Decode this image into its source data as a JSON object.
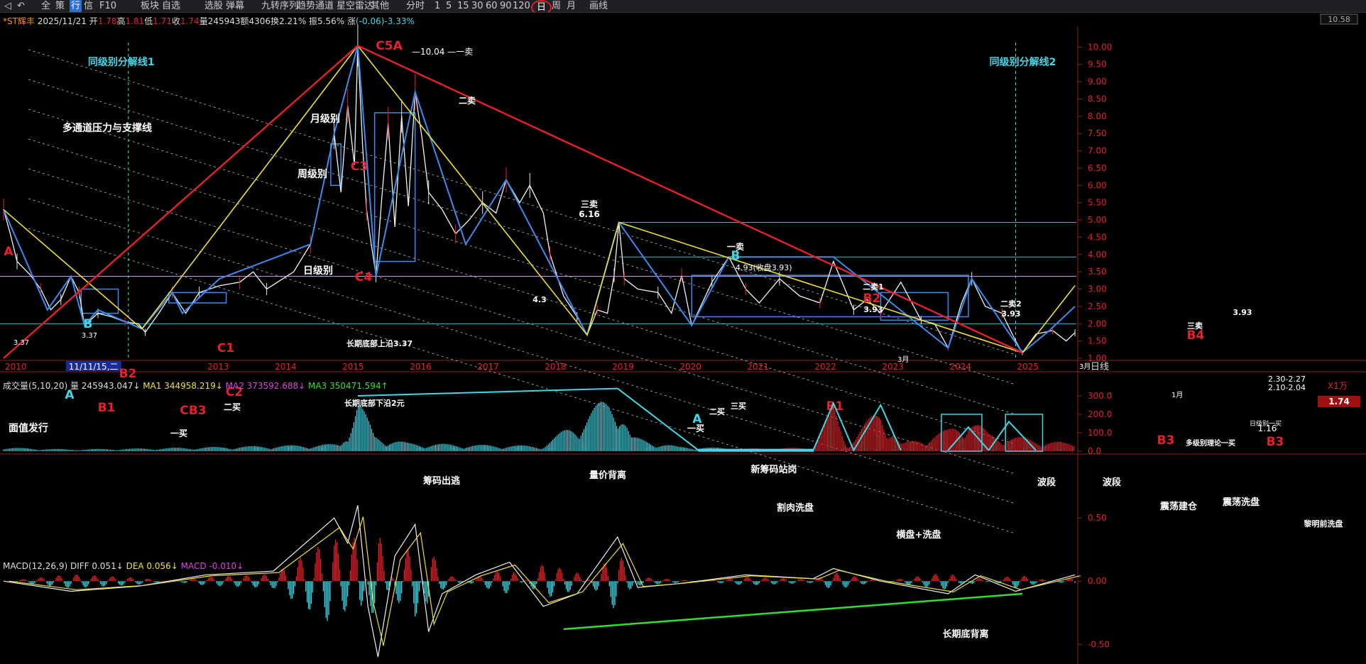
{
  "toolbar": {
    "items": [
      "全",
      "策",
      "行",
      "信",
      "F10",
      "板块",
      "自选",
      "选股",
      "弹幕",
      "九转序列",
      "趋势通道",
      "星空雷达",
      "其他",
      "分时",
      "1",
      "5",
      "15",
      "30",
      "60",
      "90",
      "120",
      "日",
      "周",
      "月",
      "画线"
    ],
    "selected": "行",
    "active_period": "日"
  },
  "header": {
    "name": "*ST辉丰",
    "date": "2025/11/21",
    "open_label": "开",
    "open": "1.78",
    "high_label": "高",
    "high": "1.81",
    "low_label": "低",
    "low": "1.71",
    "close_label": "收",
    "close": "1.74",
    "volume_label": "量",
    "volume": "245943",
    "amount_label": "额",
    "amount": "4306",
    "turnover_label": "换",
    "turnover": "2.21%",
    "amplitude_label": "振",
    "amplitude": "5.56%",
    "change_label": "涨",
    "change": "(-0.06)-3.33%"
  },
  "colors": {
    "red": "#e8202a",
    "yellow": "#f0e030",
    "blue": "#3b8bf0",
    "cyan": "#40d8e8",
    "green": "#30e030",
    "magenta": "#e040e0",
    "white": "#ffffff"
  },
  "chart_data": [
    {
      "type": "line",
      "title": "",
      "x_tick_labels": [
        "2010",
        "11/11/15,二",
        "2013",
        "2014",
        "2015",
        "2016",
        "2017",
        "2018",
        "2019",
        "2020",
        "2021",
        "2022",
        "2023",
        "2024",
        "2025"
      ],
      "x_range": [
        2010,
        2025.9
      ],
      "y_ticks": [
        1.0,
        1.5,
        2.0,
        2.5,
        3.0,
        3.5,
        4.0,
        4.5,
        5.0,
        5.5,
        6.0,
        6.5,
        7.0,
        7.5,
        8.0,
        8.5,
        9.0,
        9.5,
        10.0
      ],
      "ylim": [
        1.0,
        10.5
      ],
      "period_label": "日线",
      "current_price": "1.74",
      "top_box_value": "10.58",
      "price_path": [
        [
          2010.0,
          5.3
        ],
        [
          2010.1,
          4.6
        ],
        [
          2010.2,
          3.8
        ],
        [
          2010.4,
          3.4
        ],
        [
          2010.55,
          3.0
        ],
        [
          2010.7,
          2.4
        ],
        [
          2010.85,
          2.7
        ],
        [
          2011.0,
          3.37
        ],
        [
          2011.12,
          2.9
        ],
        [
          2011.2,
          1.95
        ],
        [
          2011.4,
          2.3
        ],
        [
          2011.6,
          2.2
        ],
        [
          2011.8,
          2.05
        ],
        [
          2012.0,
          2.0
        ],
        [
          2012.1,
          1.75
        ],
        [
          2012.3,
          2.3
        ],
        [
          2012.5,
          2.9
        ],
        [
          2012.7,
          2.3
        ],
        [
          2012.9,
          2.9
        ],
        [
          2013.2,
          3.1
        ],
        [
          2013.5,
          3.2
        ],
        [
          2013.7,
          3.5
        ],
        [
          2013.9,
          3.0
        ],
        [
          2014.3,
          3.5
        ],
        [
          2014.55,
          4.3
        ],
        [
          2014.8,
          6.6
        ],
        [
          2014.9,
          7.5
        ],
        [
          2015.0,
          5.8
        ],
        [
          2015.1,
          8.3
        ],
        [
          2015.2,
          6.6
        ],
        [
          2015.25,
          10.04
        ],
        [
          2015.32,
          7.2
        ],
        [
          2015.38,
          5.3
        ],
        [
          2015.45,
          4.3
        ],
        [
          2015.52,
          3.4
        ],
        [
          2015.6,
          5.5
        ],
        [
          2015.7,
          7.8
        ],
        [
          2015.8,
          4.8
        ],
        [
          2015.9,
          8.0
        ],
        [
          2016.0,
          5.4
        ],
        [
          2016.1,
          8.7
        ],
        [
          2016.2,
          7.4
        ],
        [
          2016.3,
          5.8
        ],
        [
          2016.5,
          5.3
        ],
        [
          2016.7,
          4.6
        ],
        [
          2016.9,
          5.0
        ],
        [
          2017.1,
          5.5
        ],
        [
          2017.3,
          5.2
        ],
        [
          2017.45,
          6.16
        ],
        [
          2017.65,
          5.5
        ],
        [
          2017.8,
          6.0
        ],
        [
          2018.0,
          5.2
        ],
        [
          2018.1,
          4.0
        ],
        [
          2018.3,
          2.8
        ],
        [
          2018.5,
          2.2
        ],
        [
          2018.65,
          1.67
        ],
        [
          2018.8,
          2.4
        ],
        [
          2018.95,
          2.3
        ],
        [
          2019.05,
          3.4
        ],
        [
          2019.12,
          4.93
        ],
        [
          2019.2,
          3.3
        ],
        [
          2019.4,
          3.0
        ],
        [
          2019.7,
          2.9
        ],
        [
          2019.9,
          2.3
        ],
        [
          2020.05,
          3.4
        ],
        [
          2020.2,
          1.95
        ],
        [
          2020.5,
          3.2
        ],
        [
          2020.75,
          3.93
        ],
        [
          2021.0,
          3.0
        ],
        [
          2021.2,
          2.6
        ],
        [
          2021.5,
          3.3
        ],
        [
          2021.8,
          2.8
        ],
        [
          2022.1,
          2.6
        ],
        [
          2022.3,
          3.8
        ],
        [
          2022.6,
          2.4
        ],
        [
          2022.8,
          2.7
        ],
        [
          2023.0,
          2.3
        ],
        [
          2023.3,
          3.2
        ],
        [
          2023.6,
          2.1
        ],
        [
          2023.8,
          2.0
        ],
        [
          2024.0,
          1.3
        ],
        [
          2024.2,
          2.6
        ],
        [
          2024.35,
          3.3
        ],
        [
          2024.55,
          2.5
        ],
        [
          2024.8,
          2.3
        ],
        [
          2025.0,
          1.5
        ],
        [
          2025.1,
          1.16
        ],
        [
          2025.3,
          1.7
        ],
        [
          2025.55,
          1.8
        ],
        [
          2025.75,
          1.5
        ],
        [
          2025.88,
          1.74
        ]
      ],
      "blue_swings": [
        [
          2010.0,
          5.3
        ],
        [
          2010.65,
          2.4
        ],
        [
          2011.0,
          3.37
        ],
        [
          2011.2,
          1.95
        ],
        [
          2011.4,
          2.4
        ],
        [
          2012.05,
          1.85
        ],
        [
          2012.5,
          2.9
        ],
        [
          2012.65,
          2.3
        ],
        [
          2013.2,
          3.3
        ],
        [
          2014.55,
          4.3
        ],
        [
          2014.9,
          7.5
        ],
        [
          2015.25,
          10.04
        ],
        [
          2015.52,
          3.37
        ],
        [
          2016.1,
          8.7
        ],
        [
          2016.85,
          4.3
        ],
        [
          2017.45,
          6.16
        ],
        [
          2018.65,
          1.67
        ],
        [
          2019.12,
          4.93
        ],
        [
          2020.2,
          1.95
        ],
        [
          2020.75,
          3.93
        ],
        [
          2022.3,
          3.93
        ],
        [
          2024.0,
          1.3
        ],
        [
          2024.35,
          3.3
        ],
        [
          2025.1,
          1.16
        ],
        [
          2025.5,
          1.8
        ],
        [
          2025.88,
          2.5
        ]
      ],
      "yellow_lines": [
        [
          [
            2010.0,
            5.3
          ],
          [
            2012.05,
            1.85
          ]
        ],
        [
          [
            2012.05,
            1.85
          ],
          [
            2015.25,
            10.04
          ]
        ],
        [
          [
            2015.25,
            10.04
          ],
          [
            2018.65,
            1.67
          ]
        ],
        [
          [
            2018.65,
            1.67
          ],
          [
            2019.12,
            4.93
          ]
        ],
        [
          [
            2019.12,
            4.93
          ],
          [
            2025.1,
            1.16
          ]
        ],
        [
          [
            2025.1,
            1.16
          ],
          [
            2025.88,
            3.1
          ]
        ]
      ],
      "red_lines": [
        [
          [
            2010.0,
            1.0
          ],
          [
            2015.25,
            10.04
          ]
        ],
        [
          [
            2015.25,
            10.04
          ],
          [
            2025.1,
            1.16
          ]
        ]
      ],
      "horizontal_levels": [
        2.0,
        3.37,
        3.93,
        4.93
      ],
      "vertical_lines": [
        2011.85,
        2025.0
      ],
      "labels": {
        "fen_jie_1": "同级别分解线1",
        "fen_jie_2": "同级别分解线2",
        "channel": "多通道压力与支撑线",
        "monthly": "月级别",
        "weekly": "周级别",
        "daily": "日级别",
        "ipo": "面值发行",
        "upper_bottom": "长期底部上沿3.37",
        "lower_bottom": "长期底部下沿2元",
        "peak_price": "10.04",
        "peak_label": "C5A",
        "peak_sell": "一卖",
        "first_buy": "一买",
        "second_sell": "二卖",
        "third_sell": "三卖",
        "second_buy": "二买",
        "third_buy": "三买",
        "v_6_16": "6.16",
        "v_4_3": "4.3",
        "v_4_93": "4.93(收盘3.93)",
        "v_3_93": "3.93",
        "v_3_37": "3.37",
        "v_2_30": "2.30-2.27",
        "v_2_10": "2.10-2.04",
        "v_1_16": "1.16",
        "sell2_1": "二卖1",
        "sell2_2": "二卖2",
        "multi_theory": "多级别理论一买",
        "month_buy": "日级别一买",
        "mon": "3月",
        "mon1": "1月",
        "A": "A",
        "B": "B",
        "B1": "B1",
        "B2": "B2",
        "B3": "B3",
        "B4": "B4",
        "C1": "C1",
        "C2": "C2",
        "C3": "C3",
        "C4": "C4",
        "CB3": "CB3",
        "A1": "A"
      }
    },
    {
      "type": "bar",
      "title": "成交量(5,10,20)",
      "volume_label": "量",
      "volume_value": "245943.047↓",
      "ma1_label": "MA1",
      "ma1_value": "344958.219↓",
      "ma2_label": "MA2",
      "ma2_value": "373592.688↓",
      "ma3_label": "MA3",
      "ma3_value": "350471.594↑",
      "unit": "X1万",
      "y_ticks": [
        "300.0",
        "200.0",
        "100.0",
        "0.0"
      ],
      "ylim": [
        0,
        350
      ],
      "envelope": [
        [
          2010.0,
          20
        ],
        [
          2011.0,
          10
        ],
        [
          2012.0,
          15
        ],
        [
          2013.0,
          22
        ],
        [
          2014.0,
          30
        ],
        [
          2015.0,
          40
        ],
        [
          2015.25,
          300
        ],
        [
          2015.5,
          90
        ],
        [
          2016.0,
          45
        ],
        [
          2017.0,
          35
        ],
        [
          2018.0,
          30
        ],
        [
          2019.1,
          340
        ],
        [
          2019.3,
          80
        ],
        [
          2020.0,
          25
        ],
        [
          2021.0,
          15
        ],
        [
          2022.0,
          20
        ],
        [
          2022.3,
          260
        ],
        [
          2022.5,
          40
        ],
        [
          2023.0,
          250
        ],
        [
          2023.3,
          40
        ],
        [
          2024.0,
          120
        ],
        [
          2024.3,
          200
        ],
        [
          2024.6,
          100
        ],
        [
          2025.0,
          80
        ],
        [
          2025.88,
          40
        ]
      ],
      "annotations": {
        "chip_out": "筹码出逃",
        "divergence": "量价背离",
        "new_chip": "新筹码站岗",
        "wash": "割肉洗盘",
        "flat_wash": "横盘+洗盘",
        "wave1": "波段",
        "wave2": "波段",
        "build": "震荡建仓",
        "shake": "震荡洗盘",
        "pre_dawn": "黎明前洗盘"
      }
    },
    {
      "type": "line",
      "title": "MACD(12,26,9)",
      "diff_label": "DIFF",
      "diff_value": "0.051↓",
      "dea_label": "DEA",
      "dea_value": "0.056↓",
      "macd_label": "MACD",
      "macd_value": "-0.010↓",
      "y_ticks": [
        "0.50",
        "0.00",
        "-0.50"
      ],
      "ylim": [
        -0.65,
        0.95
      ],
      "diff": [
        [
          2010.0,
          0.0
        ],
        [
          2011.0,
          -0.08
        ],
        [
          2012.0,
          -0.04
        ],
        [
          2013.0,
          0.05
        ],
        [
          2014.0,
          0.08
        ],
        [
          2014.9,
          0.5
        ],
        [
          2015.1,
          0.3
        ],
        [
          2015.25,
          0.6
        ],
        [
          2015.4,
          -0.2
        ],
        [
          2015.55,
          -0.6
        ],
        [
          2015.8,
          0.2
        ],
        [
          2016.1,
          0.45
        ],
        [
          2016.3,
          -0.4
        ],
        [
          2016.5,
          -0.1
        ],
        [
          2017.0,
          0.05
        ],
        [
          2017.5,
          0.15
        ],
        [
          2018.0,
          -0.2
        ],
        [
          2018.5,
          -0.1
        ],
        [
          2019.1,
          0.35
        ],
        [
          2019.4,
          -0.05
        ],
        [
          2020.0,
          -0.02
        ],
        [
          2021.0,
          0.05
        ],
        [
          2022.0,
          0.02
        ],
        [
          2022.3,
          0.1
        ],
        [
          2023.0,
          0.0
        ],
        [
          2024.0,
          -0.1
        ],
        [
          2024.4,
          0.05
        ],
        [
          2025.0,
          -0.08
        ],
        [
          2025.88,
          0.05
        ]
      ],
      "green_line": [
        [
          2018.3,
          -0.38
        ],
        [
          2025.1,
          -0.1
        ]
      ],
      "annotation": "长期底背离"
    }
  ]
}
